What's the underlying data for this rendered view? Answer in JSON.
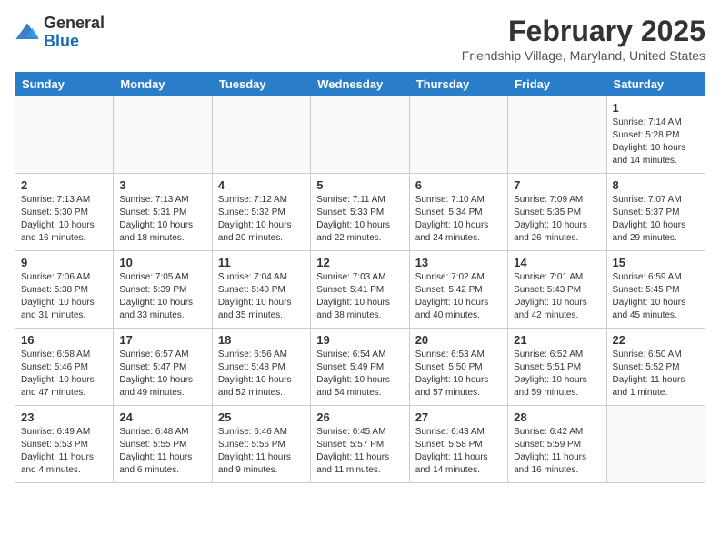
{
  "header": {
    "logo_general": "General",
    "logo_blue": "Blue",
    "month_title": "February 2025",
    "location": "Friendship Village, Maryland, United States"
  },
  "weekdays": [
    "Sunday",
    "Monday",
    "Tuesday",
    "Wednesday",
    "Thursday",
    "Friday",
    "Saturday"
  ],
  "weeks": [
    [
      {
        "day": "",
        "info": ""
      },
      {
        "day": "",
        "info": ""
      },
      {
        "day": "",
        "info": ""
      },
      {
        "day": "",
        "info": ""
      },
      {
        "day": "",
        "info": ""
      },
      {
        "day": "",
        "info": ""
      },
      {
        "day": "1",
        "info": "Sunrise: 7:14 AM\nSunset: 5:28 PM\nDaylight: 10 hours and 14 minutes."
      }
    ],
    [
      {
        "day": "2",
        "info": "Sunrise: 7:13 AM\nSunset: 5:30 PM\nDaylight: 10 hours and 16 minutes."
      },
      {
        "day": "3",
        "info": "Sunrise: 7:13 AM\nSunset: 5:31 PM\nDaylight: 10 hours and 18 minutes."
      },
      {
        "day": "4",
        "info": "Sunrise: 7:12 AM\nSunset: 5:32 PM\nDaylight: 10 hours and 20 minutes."
      },
      {
        "day": "5",
        "info": "Sunrise: 7:11 AM\nSunset: 5:33 PM\nDaylight: 10 hours and 22 minutes."
      },
      {
        "day": "6",
        "info": "Sunrise: 7:10 AM\nSunset: 5:34 PM\nDaylight: 10 hours and 24 minutes."
      },
      {
        "day": "7",
        "info": "Sunrise: 7:09 AM\nSunset: 5:35 PM\nDaylight: 10 hours and 26 minutes."
      },
      {
        "day": "8",
        "info": "Sunrise: 7:07 AM\nSunset: 5:37 PM\nDaylight: 10 hours and 29 minutes."
      }
    ],
    [
      {
        "day": "9",
        "info": "Sunrise: 7:06 AM\nSunset: 5:38 PM\nDaylight: 10 hours and 31 minutes."
      },
      {
        "day": "10",
        "info": "Sunrise: 7:05 AM\nSunset: 5:39 PM\nDaylight: 10 hours and 33 minutes."
      },
      {
        "day": "11",
        "info": "Sunrise: 7:04 AM\nSunset: 5:40 PM\nDaylight: 10 hours and 35 minutes."
      },
      {
        "day": "12",
        "info": "Sunrise: 7:03 AM\nSunset: 5:41 PM\nDaylight: 10 hours and 38 minutes."
      },
      {
        "day": "13",
        "info": "Sunrise: 7:02 AM\nSunset: 5:42 PM\nDaylight: 10 hours and 40 minutes."
      },
      {
        "day": "14",
        "info": "Sunrise: 7:01 AM\nSunset: 5:43 PM\nDaylight: 10 hours and 42 minutes."
      },
      {
        "day": "15",
        "info": "Sunrise: 6:59 AM\nSunset: 5:45 PM\nDaylight: 10 hours and 45 minutes."
      }
    ],
    [
      {
        "day": "16",
        "info": "Sunrise: 6:58 AM\nSunset: 5:46 PM\nDaylight: 10 hours and 47 minutes."
      },
      {
        "day": "17",
        "info": "Sunrise: 6:57 AM\nSunset: 5:47 PM\nDaylight: 10 hours and 49 minutes."
      },
      {
        "day": "18",
        "info": "Sunrise: 6:56 AM\nSunset: 5:48 PM\nDaylight: 10 hours and 52 minutes."
      },
      {
        "day": "19",
        "info": "Sunrise: 6:54 AM\nSunset: 5:49 PM\nDaylight: 10 hours and 54 minutes."
      },
      {
        "day": "20",
        "info": "Sunrise: 6:53 AM\nSunset: 5:50 PM\nDaylight: 10 hours and 57 minutes."
      },
      {
        "day": "21",
        "info": "Sunrise: 6:52 AM\nSunset: 5:51 PM\nDaylight: 10 hours and 59 minutes."
      },
      {
        "day": "22",
        "info": "Sunrise: 6:50 AM\nSunset: 5:52 PM\nDaylight: 11 hours and 1 minute."
      }
    ],
    [
      {
        "day": "23",
        "info": "Sunrise: 6:49 AM\nSunset: 5:53 PM\nDaylight: 11 hours and 4 minutes."
      },
      {
        "day": "24",
        "info": "Sunrise: 6:48 AM\nSunset: 5:55 PM\nDaylight: 11 hours and 6 minutes."
      },
      {
        "day": "25",
        "info": "Sunrise: 6:46 AM\nSunset: 5:56 PM\nDaylight: 11 hours and 9 minutes."
      },
      {
        "day": "26",
        "info": "Sunrise: 6:45 AM\nSunset: 5:57 PM\nDaylight: 11 hours and 11 minutes."
      },
      {
        "day": "27",
        "info": "Sunrise: 6:43 AM\nSunset: 5:58 PM\nDaylight: 11 hours and 14 minutes."
      },
      {
        "day": "28",
        "info": "Sunrise: 6:42 AM\nSunset: 5:59 PM\nDaylight: 11 hours and 16 minutes."
      },
      {
        "day": "",
        "info": ""
      }
    ]
  ]
}
